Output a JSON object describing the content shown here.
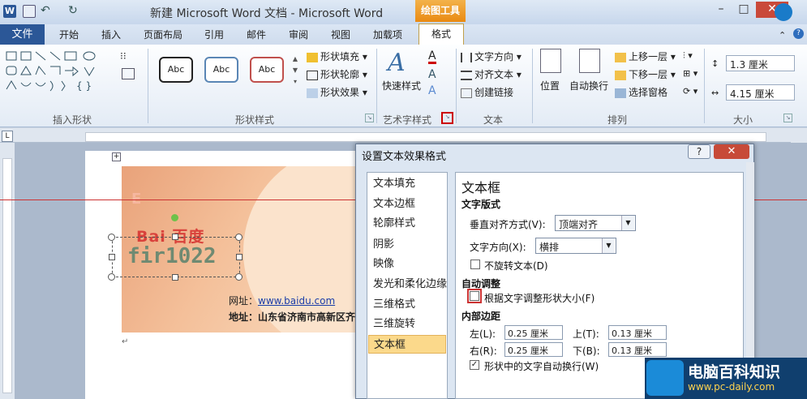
{
  "title_bar": {
    "app_title": "新建 Microsoft Word 文档 - Microsoft Word",
    "context_tab_group": "绘图工具"
  },
  "tabs": [
    "文件",
    "开始",
    "插入",
    "页面布局",
    "引用",
    "邮件",
    "审阅",
    "视图",
    "加载项",
    "格式"
  ],
  "ribbon": {
    "insert_shapes": {
      "label": "插入形状"
    },
    "shape_styles": {
      "label": "形状样式",
      "presets": [
        "Abc",
        "Abc",
        "Abc"
      ],
      "fill": "形状填充",
      "outline": "形状轮廓",
      "effects": "形状效果"
    },
    "wordart": {
      "label": "艺术字样式",
      "quick_styles": "快速样式"
    },
    "text": {
      "label": "文本",
      "direction": "文字方向",
      "align": "对齐文本",
      "create_link": "创建链接"
    },
    "arrange": {
      "label": "排列",
      "position": "位置",
      "wrap": "自动换行",
      "bring_forward": "上移一层",
      "send_backward": "下移一层",
      "selection_pane": "选择窗格"
    },
    "size": {
      "label": "大小",
      "height": "1.3 厘米",
      "width": "4.15 厘米"
    }
  },
  "card": {
    "logo_text": "Bai 百度",
    "textbox_text": "fir1022",
    "url_label": "网址：",
    "url_value": "www.baidu.com",
    "addr_label": "地址：",
    "addr_value": "山东省济南市高新区齐"
  },
  "dialog": {
    "title": "设置文本效果格式",
    "help": "?",
    "close": "✕",
    "nav": [
      "文本填充",
      "文本边框",
      "轮廓样式",
      "阴影",
      "映像",
      "发光和柔化边缘",
      "三维格式",
      "三维旋转",
      "文本框"
    ],
    "panel_title": "文本框",
    "layout_header": "文字版式",
    "vertical_align_label": "垂直对齐方式(V):",
    "vertical_align_value": "顶端对齐",
    "text_direction_label": "文字方向(X):",
    "text_direction_value": "横排",
    "no_rotate": "不旋转文本(D)",
    "autofit_header": "自动调整",
    "resize_shape": "根据文字调整形状大小(F)",
    "margins_header": "内部边距",
    "left_label": "左(L):",
    "left_value": "0.25 厘米",
    "top_label": "上(T):",
    "top_value": "0.13 厘米",
    "right_label": "右(R):",
    "right_value": "0.25 厘米",
    "bottom_label": "下(B):",
    "bottom_value": "0.13 厘米",
    "wrap_text": "形状中的文字自动换行(W)"
  },
  "watermark": {
    "text": "电脑百科知识",
    "url": "www.pc-daily.com"
  },
  "colors": {
    "accent": "#2b5797",
    "context_tab": "#e98a12",
    "selected_nav": "#fbd98b",
    "highlight_red": "#c33"
  }
}
